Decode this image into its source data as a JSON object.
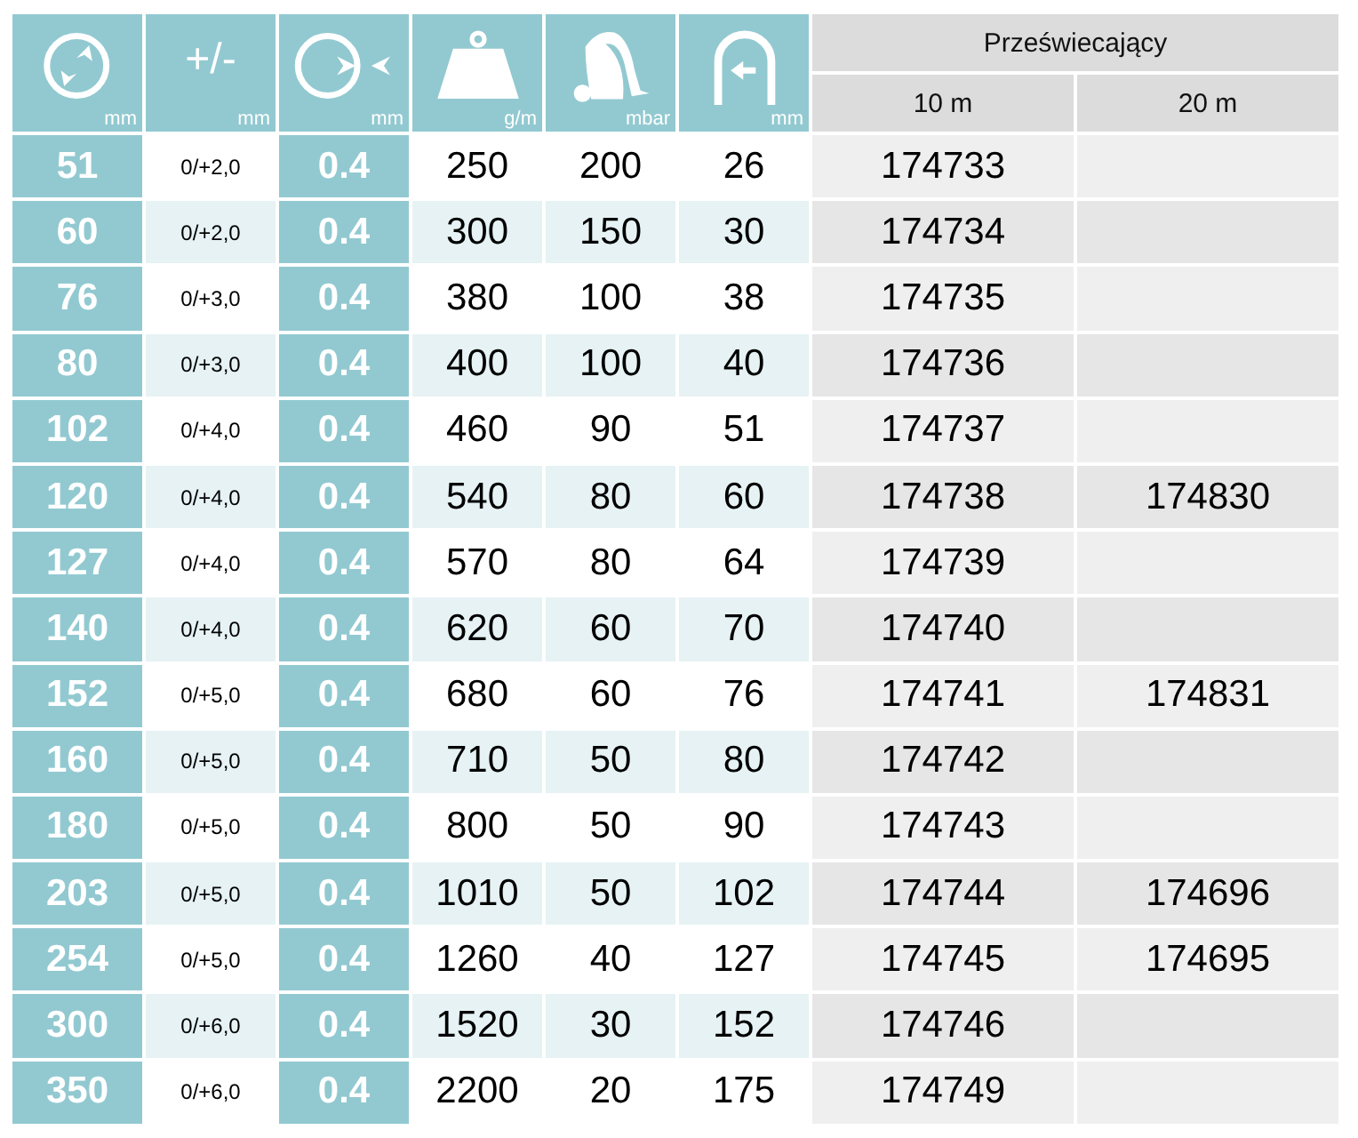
{
  "header": {
    "columns": [
      {
        "kind": "ring-arrows",
        "unit": "mm"
      },
      {
        "kind": "text",
        "symbol": "+/-",
        "unit": "mm"
      },
      {
        "kind": "ring-pinch",
        "unit": "mm"
      },
      {
        "kind": "weight",
        "unit": "g/m"
      },
      {
        "kind": "vacuum",
        "unit": "mbar"
      },
      {
        "kind": "arch",
        "unit": "mm"
      }
    ],
    "group": "Przeświecający",
    "lengths": [
      "10 m",
      "20 m"
    ]
  },
  "rows": [
    {
      "diameter": "51",
      "tolerance": "0/+2,0",
      "thickness": "0.4",
      "weight": "250",
      "vacuum": "200",
      "radius": "26",
      "ref_10m": "174733",
      "ref_20m": ""
    },
    {
      "diameter": "60",
      "tolerance": "0/+2,0",
      "thickness": "0.4",
      "weight": "300",
      "vacuum": "150",
      "radius": "30",
      "ref_10m": "174734",
      "ref_20m": ""
    },
    {
      "diameter": "76",
      "tolerance": "0/+3,0",
      "thickness": "0.4",
      "weight": "380",
      "vacuum": "100",
      "radius": "38",
      "ref_10m": "174735",
      "ref_20m": ""
    },
    {
      "diameter": "80",
      "tolerance": "0/+3,0",
      "thickness": "0.4",
      "weight": "400",
      "vacuum": "100",
      "radius": "40",
      "ref_10m": "174736",
      "ref_20m": ""
    },
    {
      "diameter": "102",
      "tolerance": "0/+4,0",
      "thickness": "0.4",
      "weight": "460",
      "vacuum": "90",
      "radius": "51",
      "ref_10m": "174737",
      "ref_20m": ""
    },
    {
      "diameter": "120",
      "tolerance": "0/+4,0",
      "thickness": "0.4",
      "weight": "540",
      "vacuum": "80",
      "radius": "60",
      "ref_10m": "174738",
      "ref_20m": "174830"
    },
    {
      "diameter": "127",
      "tolerance": "0/+4,0",
      "thickness": "0.4",
      "weight": "570",
      "vacuum": "80",
      "radius": "64",
      "ref_10m": "174739",
      "ref_20m": ""
    },
    {
      "diameter": "140",
      "tolerance": "0/+4,0",
      "thickness": "0.4",
      "weight": "620",
      "vacuum": "60",
      "radius": "70",
      "ref_10m": "174740",
      "ref_20m": ""
    },
    {
      "diameter": "152",
      "tolerance": "0/+5,0",
      "thickness": "0.4",
      "weight": "680",
      "vacuum": "60",
      "radius": "76",
      "ref_10m": "174741",
      "ref_20m": "174831"
    },
    {
      "diameter": "160",
      "tolerance": "0/+5,0",
      "thickness": "0.4",
      "weight": "710",
      "vacuum": "50",
      "radius": "80",
      "ref_10m": "174742",
      "ref_20m": ""
    },
    {
      "diameter": "180",
      "tolerance": "0/+5,0",
      "thickness": "0.4",
      "weight": "800",
      "vacuum": "50",
      "radius": "90",
      "ref_10m": "174743",
      "ref_20m": ""
    },
    {
      "diameter": "203",
      "tolerance": "0/+5,0",
      "thickness": "0.4",
      "weight": "1010",
      "vacuum": "50",
      "radius": "102",
      "ref_10m": "174744",
      "ref_20m": "174696"
    },
    {
      "diameter": "254",
      "tolerance": "0/+5,0",
      "thickness": "0.4",
      "weight": "1260",
      "vacuum": "40",
      "radius": "127",
      "ref_10m": "174745",
      "ref_20m": "174695"
    },
    {
      "diameter": "300",
      "tolerance": "0/+6,0",
      "thickness": "0.4",
      "weight": "1520",
      "vacuum": "30",
      "radius": "152",
      "ref_10m": "174746",
      "ref_20m": ""
    },
    {
      "diameter": "350",
      "tolerance": "0/+6,0",
      "thickness": "0.4",
      "weight": "2200",
      "vacuum": "20",
      "radius": "175",
      "ref_10m": "174749",
      "ref_20m": ""
    }
  ]
}
